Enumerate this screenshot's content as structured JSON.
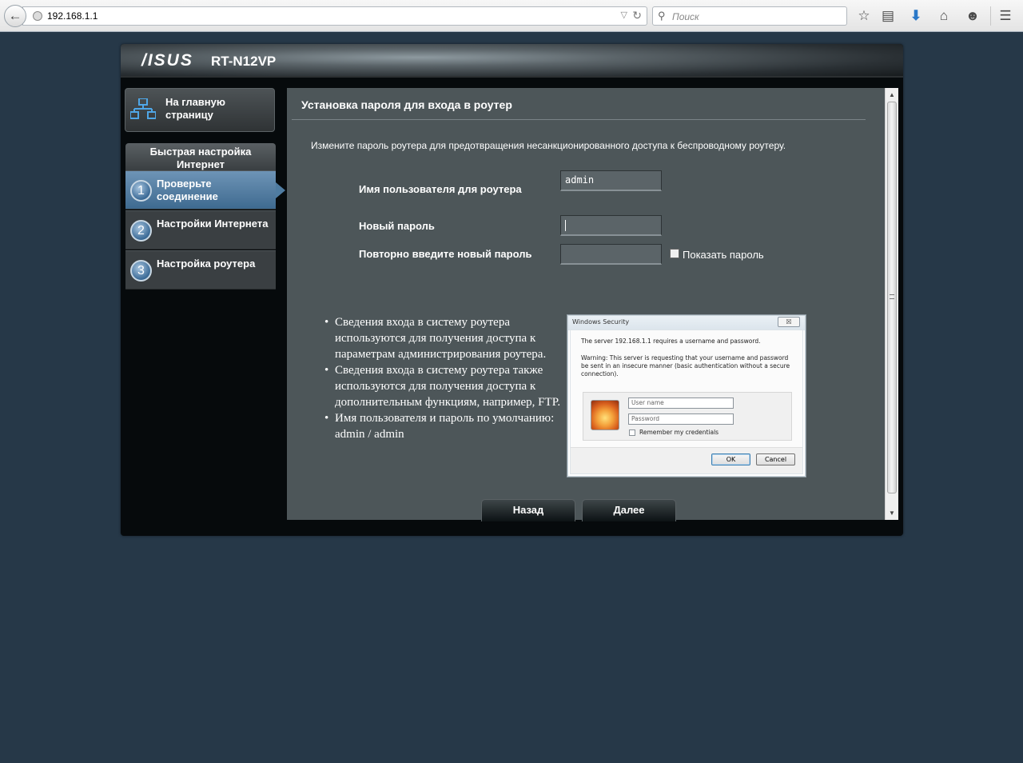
{
  "browser": {
    "url": "192.168.1.1",
    "search_placeholder": "Поиск"
  },
  "router": {
    "brand": "/ISUS",
    "model": "RT-N12VP"
  },
  "sidebar": {
    "home_label": "На главную страницу",
    "qis_header": "Быстрая настройка Интернет",
    "steps": [
      {
        "num": "1",
        "label": "Проверьте соединение",
        "active": true
      },
      {
        "num": "2",
        "label": "Настройки Интернета",
        "active": false
      },
      {
        "num": "3",
        "label": "Настройка роутера",
        "active": false
      }
    ]
  },
  "main": {
    "title": "Установка пароля для входа в роутер",
    "intro": "Измените пароль роутера для предотвращения несанкционированного доступа к беспроводному роутеру.",
    "fields": {
      "username_label": "Имя пользователя для роутера",
      "username_value": "admin",
      "new_password_label": "Новый пароль",
      "new_password_value": "",
      "confirm_password_label": "Повторно введите новый пароль",
      "confirm_password_value": "",
      "show_password_label": "Показать пароль"
    },
    "info": [
      "Сведения входа в систему роутера используются для получения доступа к параметрам администрирования роутера.",
      "Сведения входа в систему роутера также используются для получения доступа к дополнительным функциям, например, FTP.",
      "Имя пользователя и пароль по умолчанию: admin / admin"
    ],
    "dialog": {
      "title": "Windows Security",
      "close_label": "☒",
      "line1": "The server 192.168.1.1  requires a username and password.",
      "warning": "Warning: This server is requesting that your username and password be sent in an insecure manner (basic authentication without a secure connection).",
      "username_placeholder": "User name",
      "password_placeholder": "Password",
      "remember_label": "Remember my credentials",
      "ok_label": "OK",
      "cancel_label": "Cancel"
    },
    "buttons": {
      "back_label": "Назад",
      "next_label": "Далее"
    }
  },
  "colors": {
    "page_bg": "#263848",
    "panel_bg": "#4d5659",
    "active_step": "#4f7ca1"
  }
}
